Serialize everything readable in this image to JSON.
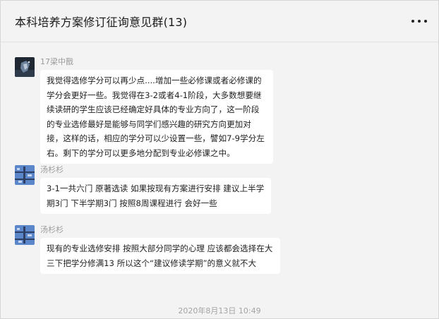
{
  "chat": {
    "title": "本科培养方案修订征询意见群(13)"
  },
  "messages": [
    {
      "sender": "17梁中戬",
      "avatar": "dark-photo-avatar",
      "text": "我觉得选修学分可以再少点....增加一些必修课或者必修课的学分会更好一些。我觉得在3-2或者4-1阶段，大多数想要继续读研的学生应该已经确定好具体的专业方向了，这一阶段的专业选修最好是能够与同学们感兴趣的研究方向更加对接，这样的话，相应的学分可以少设置一些，譬如7-9学分左右。剩下的学分可以更多地分配到专业必修课之中。"
    },
    {
      "sender": "汤杉杉",
      "avatar": "blue-pattern-avatar",
      "text": "3-1一共六门 原著选读  如果按现有方案进行安排 建议上半学期3门 下半学期3门  按照8周课程进行 会好一些"
    },
    {
      "sender": "汤杉杉",
      "avatar": "blue-pattern-avatar",
      "text": "现有的专业选修安排 按照大部分同学的心理 应该都会选择在大三下把学分修满13 所以这个“建议修读学期”的意义就不大"
    }
  ],
  "timestamp": "2020年8月13日 10:49",
  "colors": {
    "background": "#f3f3f3",
    "bubble": "#ffffff",
    "avatar_blue": "#5b86c9"
  }
}
